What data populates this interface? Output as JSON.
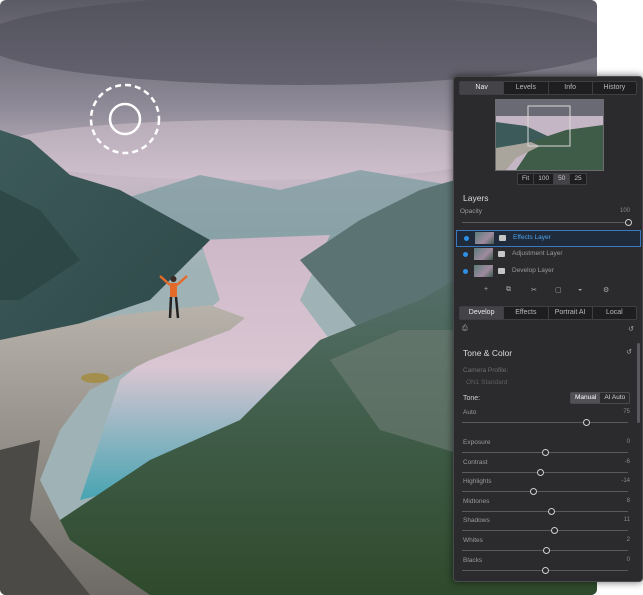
{
  "panel": {
    "tabs": [
      "Nav",
      "Levels",
      "Info",
      "History"
    ],
    "active_tab": "Nav",
    "zoom_options": [
      "Fit",
      "100",
      "50",
      "25"
    ],
    "active_zoom": "50",
    "layers_title": "Layers",
    "opacity_label": "Opacity",
    "opacity_value": "100",
    "layers": [
      {
        "name": "Effects Layer",
        "selected": true
      },
      {
        "name": "Adjustment Layer",
        "selected": false
      },
      {
        "name": "Develop Layer",
        "selected": false
      }
    ],
    "layer_tools": [
      "+",
      "⧉",
      "✂",
      "▢",
      "◒",
      "⚙"
    ],
    "module_tabs": [
      "Develop",
      "Effects",
      "Portrait AI",
      "Local"
    ],
    "active_module": "Develop",
    "section_title": "Tone & Color",
    "camera_profile_label": "Camera Profile:",
    "camera_profile_value": "ON1 Standard",
    "tone_label": "Tone:",
    "tone_manual": "Manual",
    "tone_ai": "AI Auto",
    "auto_label": "Auto",
    "auto_value": "75",
    "sliders": [
      {
        "label": "Exposure",
        "value": "0"
      },
      {
        "label": "Contrast",
        "value": "-6"
      },
      {
        "label": "Highlights",
        "value": "-14"
      },
      {
        "label": "Midtones",
        "value": "8"
      },
      {
        "label": "Shadows",
        "value": "11"
      },
      {
        "label": "Whites",
        "value": "2"
      },
      {
        "label": "Blacks",
        "value": "0"
      }
    ],
    "slider_levels": [
      0.5,
      0.47,
      0.43,
      0.54,
      0.56,
      0.51,
      0.5
    ],
    "auto_level": 0.75,
    "opacity_level": 1.0
  }
}
